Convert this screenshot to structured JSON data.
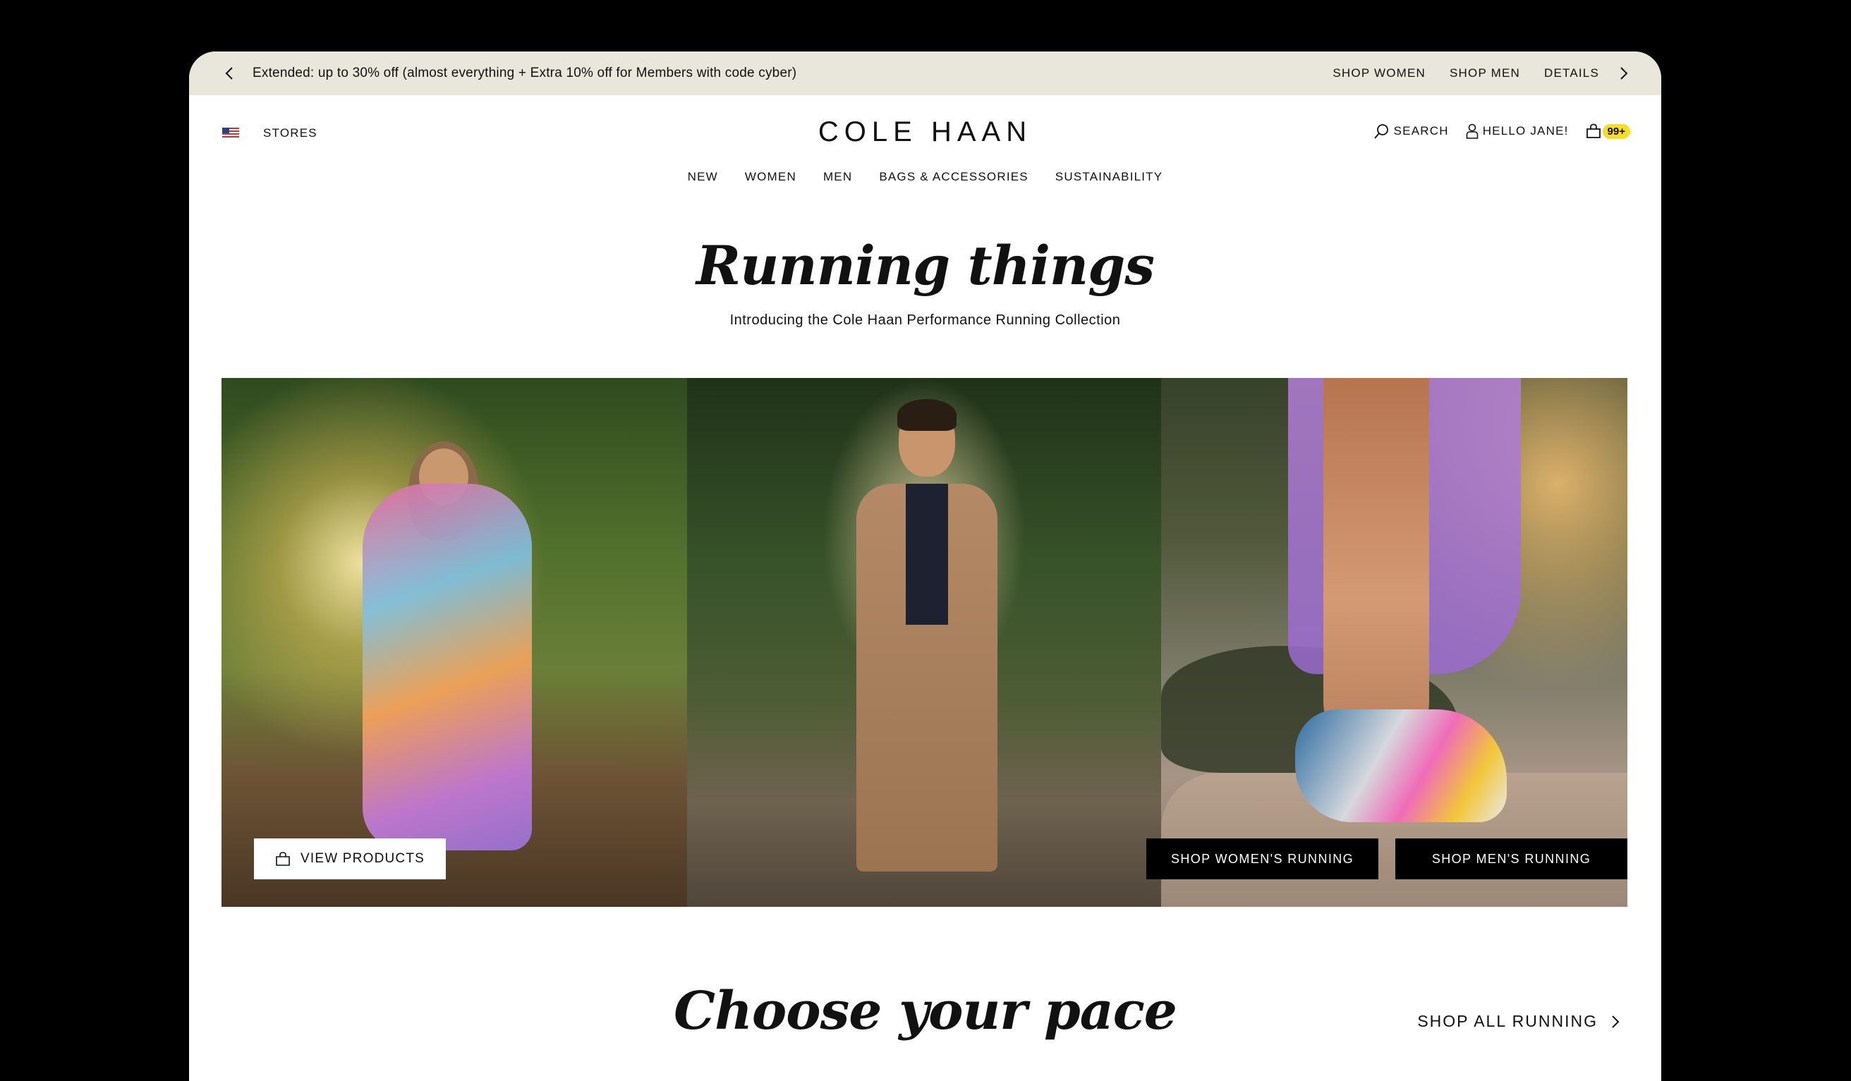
{
  "promo": {
    "message": "Extended: up to 30% off (almost everything + Extra 10% off for Members with code cyber)",
    "links": [
      "SHOP WOMEN",
      "SHOP MEN",
      "DETAILS"
    ]
  },
  "header": {
    "stores_label": "STORES",
    "logo": "COLE HAAN",
    "search_label": "SEARCH",
    "account_label": "HELLO JANE!",
    "cart_count": "99+"
  },
  "nav": [
    "NEW",
    "WOMEN",
    "MEN",
    "BAGS & ACCESSORIES",
    "SUSTAINABILITY"
  ],
  "hero": {
    "title": "Running things",
    "subtitle": "Introducing the Cole Haan Performance Running Collection",
    "view_products_label": "VIEW PRODUCTS",
    "shop_women_label": "SHOP WOMEN'S RUNNING",
    "shop_men_label": "SHOP MEN'S RUNNING"
  },
  "pace": {
    "title": "Choose your pace",
    "shop_all_label": "SHOP ALL RUNNING"
  },
  "colors": {
    "promo_bg": "#e9e7dc",
    "badge": "#f7dc2a",
    "button_dark": "#000000"
  }
}
